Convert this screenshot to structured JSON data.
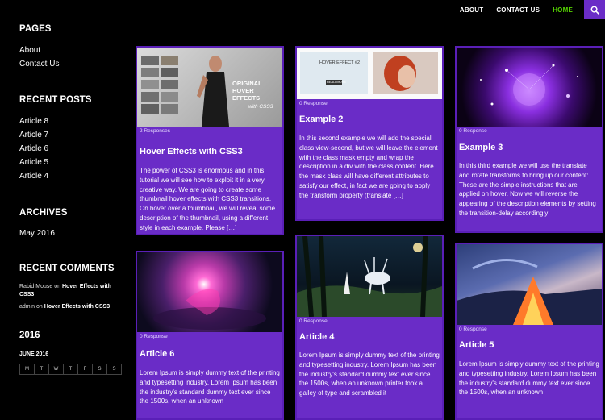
{
  "nav": {
    "about": "ABOUT",
    "contact": "CONTACT US",
    "home": "HOME"
  },
  "colors": {
    "accent": "#6a2cc7",
    "active_nav": "#55d300"
  },
  "sidebar": {
    "pages_title": "PAGES",
    "pages": [
      "About",
      "Contact Us"
    ],
    "recent_posts_title": "RECENT POSTS",
    "recent_posts": [
      "Article 8",
      "Article 7",
      "Article 6",
      "Article 5",
      "Article 4"
    ],
    "archives_title": "ARCHIVES",
    "archives": [
      "May 2016"
    ],
    "recent_comments_title": "RECENT COMMENTS",
    "comments": [
      {
        "author": "Rabid Mouse",
        "on": "on",
        "post": "Hover Effects with CSS3"
      },
      {
        "author": "admin",
        "on": "on",
        "post": "Hover Effects with CSS3"
      }
    ],
    "year_title": "2016",
    "calendar_month": "JUNE 2016",
    "calendar_days": [
      "M",
      "T",
      "W",
      "T",
      "F",
      "S",
      "S"
    ]
  },
  "posts": [
    {
      "meta": "2 Responses",
      "title": "Hover Effects with CSS3",
      "excerpt": "The power of CSS3 is enormous and in this tutorial we will see how to exploit it in a very creative way. We are going to create some thumbnail hover effects with CSS3 transitions. On hover over a thumbnail, we will reveal some description of the thumbnail, using a different style in each example. Please […]",
      "thumb_title": "ORIGINAL HOVER EFFECTS",
      "thumb_sub": "with CSS3"
    },
    {
      "meta": "0 Response",
      "title": "Example 2",
      "excerpt": "In this second example we will add the special class view-second, but we will leave the element with the class mask empty and wrap the description in a div with the class content. Here the mask class will have different attributes to satisfy our effect, in fact we are going to apply the transform property (translate […]",
      "thumb_title": "HOVER EFFECT #2",
      "thumb_button": "READ MORE"
    },
    {
      "meta": "0 Response",
      "title": "Example 3",
      "excerpt": "In this third example we will use the translate and rotate transforms to bring up our content: These are the simple instructions that are applied on hover. Now we will reverse the appearing of the description elements by setting the transition-delay accordingly:"
    },
    {
      "meta": "0 Response",
      "title": "Article 6",
      "excerpt": "Lorem Ipsum is simply dummy text of the printing and typesetting industry. Lorem Ipsum has been the industry's standard dummy text ever since the 1500s, when an unknown"
    },
    {
      "meta": "0 Response",
      "title": "Article 4",
      "excerpt": "Lorem Ipsum is simply dummy text of the printing and typesetting industry. Lorem Ipsum has been the industry's standard dummy text ever since the 1500s, when an unknown printer took a galley of type and scrambled it"
    },
    {
      "meta": "0 Response",
      "title": "Article 5",
      "excerpt": "Lorem Ipsum is simply dummy text of the printing and typesetting industry. Lorem Ipsum has been the industry's standard dummy text ever since the 1500s, when an unknown"
    }
  ]
}
